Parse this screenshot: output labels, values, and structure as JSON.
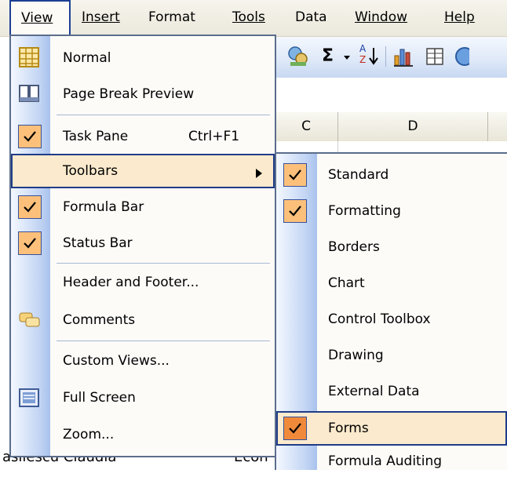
{
  "menubar": {
    "items": [
      {
        "label": "View",
        "mnemonic": "V"
      },
      {
        "label": "Insert",
        "mnemonic": "I"
      },
      {
        "label": "Format",
        "mnemonic": "o"
      },
      {
        "label": "Tools",
        "mnemonic": "T"
      },
      {
        "label": "Data",
        "mnemonic": "D"
      },
      {
        "label": "Window",
        "mnemonic": "W"
      },
      {
        "label": "Help",
        "mnemonic": "H"
      }
    ],
    "active": "View"
  },
  "toolbar": {
    "sigma": "Σ",
    "sort_top": "A",
    "sort_bottom": "Z"
  },
  "sheet": {
    "columns": [
      "C",
      "D"
    ],
    "cell_text_a": "asilescu Claudia",
    "cell_text_b": "Econ"
  },
  "view_menu": {
    "items": [
      {
        "label": "Normal",
        "u": "N",
        "icon": "normal-view-icon",
        "checked": false
      },
      {
        "label": "Page Break Preview",
        "u": "P",
        "icon": "page-break-preview-icon",
        "checked": false
      },
      {
        "label": "Task Pane",
        "u": "k",
        "shortcut": "Ctrl+F1",
        "checked": true
      },
      {
        "label": "Toolbars",
        "u": "T",
        "submenu": true,
        "highlighted": true
      },
      {
        "label": "Formula Bar",
        "u": "F",
        "checked": true
      },
      {
        "label": "Status Bar",
        "u": "S",
        "checked": true
      },
      {
        "label": "Header and Footer...",
        "u": "H",
        "checked": false
      },
      {
        "label": "Comments",
        "u": "C",
        "icon": "comments-icon",
        "checked": false
      },
      {
        "label": "Custom Views...",
        "u": "V",
        "checked": false
      },
      {
        "label": "Full Screen",
        "u": "u",
        "icon": "full-screen-icon",
        "checked": false
      },
      {
        "label": "Zoom...",
        "u": "Z",
        "checked": false
      }
    ]
  },
  "toolbars_submenu": {
    "items": [
      {
        "label": "Standard",
        "checked": true
      },
      {
        "label": "Formatting",
        "checked": true
      },
      {
        "label": "Borders",
        "checked": false
      },
      {
        "label": "Chart",
        "checked": false
      },
      {
        "label": "Control Toolbox",
        "checked": false
      },
      {
        "label": "Drawing",
        "checked": false
      },
      {
        "label": "External Data",
        "checked": false
      },
      {
        "label": "Forms",
        "checked": true,
        "highlighted": true
      },
      {
        "label": "Formula Auditing",
        "checked": false
      }
    ]
  },
  "colors": {
    "menu_border": "#5b6d8c",
    "highlight_fill": "#fbeacd",
    "highlight_border": "#1f3c88",
    "check_fill": "#fcc07a",
    "check_active_fill": "#f08a3a"
  }
}
